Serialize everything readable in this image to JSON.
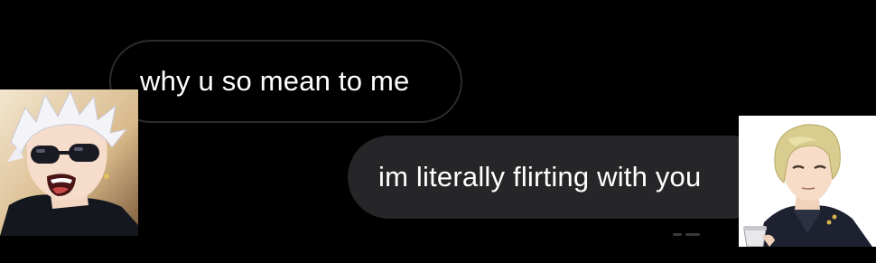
{
  "conversation": {
    "messages": [
      {
        "direction": "incoming",
        "text": "why u so mean to me"
      },
      {
        "direction": "outgoing",
        "text": "im literally flirting with you"
      }
    ],
    "colors": {
      "background": "#000000",
      "incoming_border": "#2c2c2e",
      "outgoing_fill": "#262629",
      "text": "#ffffff"
    }
  },
  "avatars": {
    "left": {
      "icon": "anime-character-white-hair-sunglasses"
    },
    "right": {
      "icon": "anime-character-blonde-hair-dark-coat"
    }
  }
}
